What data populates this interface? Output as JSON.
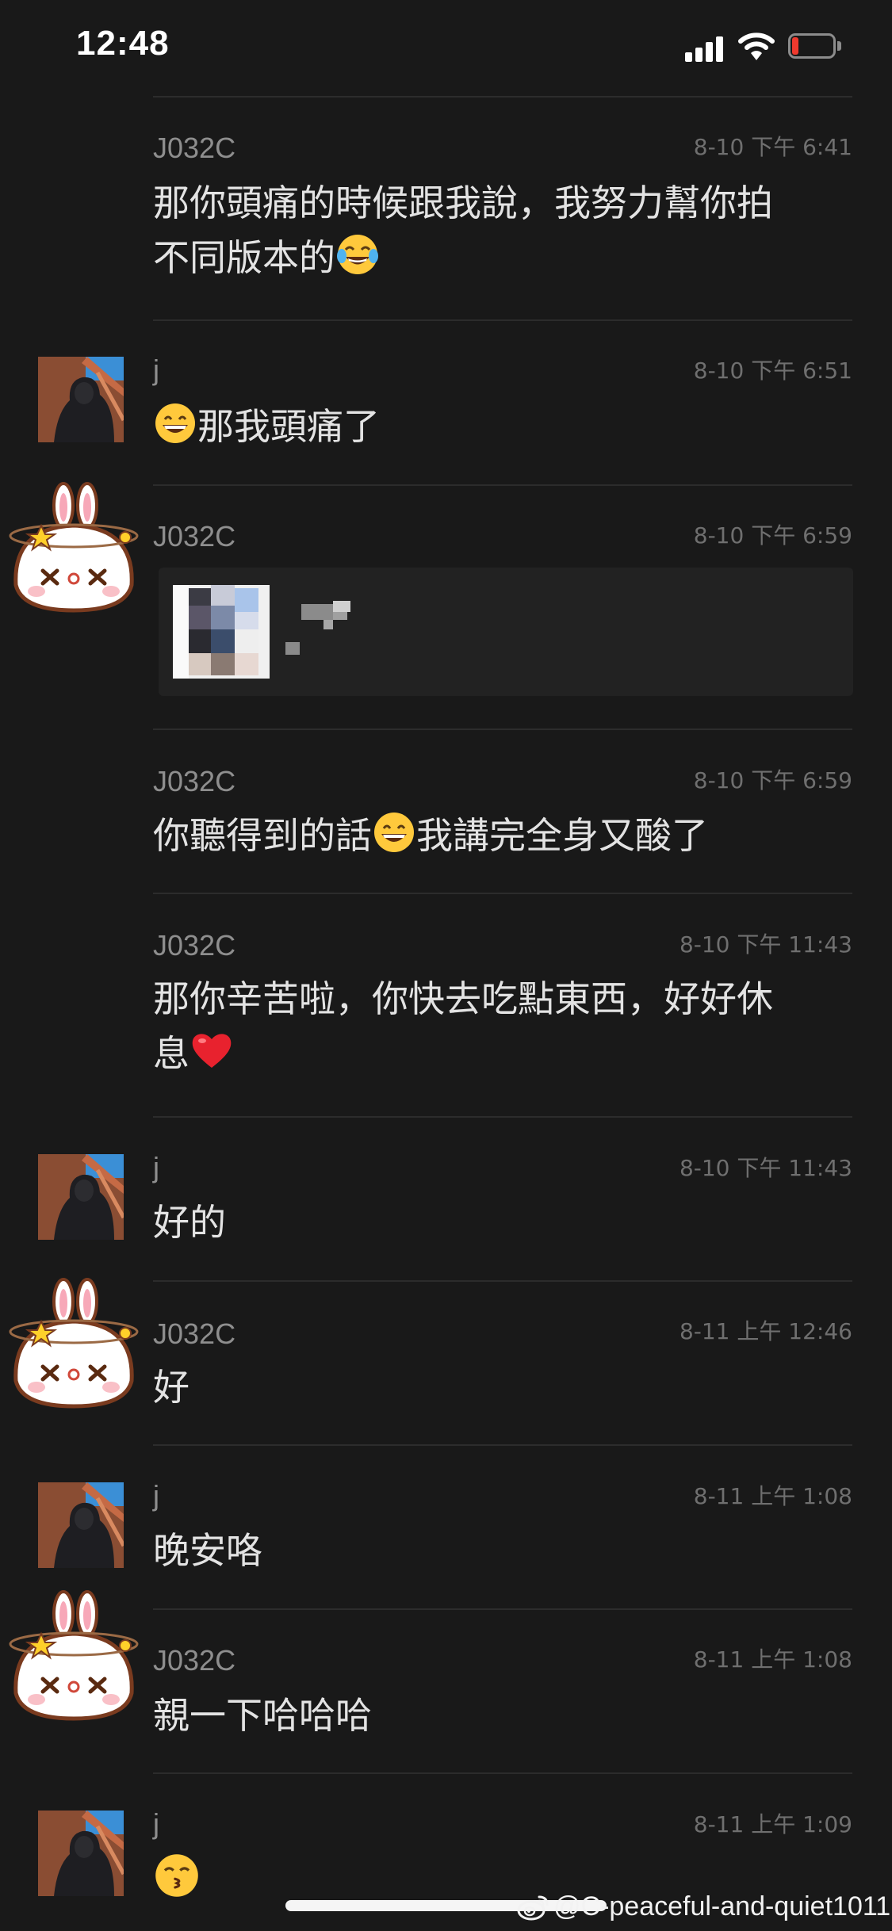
{
  "status_bar": {
    "time": "12:48",
    "icons": [
      "signal-icon",
      "wifi-icon",
      "battery-low-icon"
    ],
    "battery_color": "#f03a2e"
  },
  "messages": [
    {
      "sender": "J032C",
      "time": "8-10 下午 6:41",
      "lines": [
        "那你頭痛的時候跟我說，我努力幫你拍",
        "不同版本的"
      ],
      "trailing_emoji": "tears-of-joy-emoji"
    },
    {
      "sender": "j",
      "time": "8-10 下午 6:51",
      "leading_emoji": "grinning-emoji",
      "text": "那我頭痛了"
    },
    {
      "sender": "J032C",
      "time": "8-10 下午 6:59",
      "type": "media",
      "media": "blurred-image-thumbnail"
    },
    {
      "sender": "J032C",
      "time": "8-10 下午 6:59",
      "text_a": "你聽得到的話",
      "mid_emoji": "grinning-emoji",
      "text_b": "我講完全身又酸了"
    },
    {
      "sender": "J032C",
      "time": "8-10 下午 11:43",
      "lines": [
        "那你辛苦啦，你快去吃點東西，好好休",
        "息"
      ],
      "trailing_emoji": "red-heart-emoji"
    },
    {
      "sender": "j",
      "time": "8-10 下午 11:43",
      "text": "好的"
    },
    {
      "sender": "J032C",
      "time": "8-11 上午 12:46",
      "text": "好"
    },
    {
      "sender": "j",
      "time": "8-11 上午 1:08",
      "text": "晚安咯"
    },
    {
      "sender": "J032C",
      "time": "8-11 上午 1:08",
      "text": "親一下哈哈哈"
    },
    {
      "sender": "j",
      "time": "8-11 上午 1:09",
      "leading_emoji": "kissing-emoji"
    }
  ],
  "watermark": {
    "text": "@C-peaceful-and-quiet1011",
    "icon": "weibo-icon"
  }
}
